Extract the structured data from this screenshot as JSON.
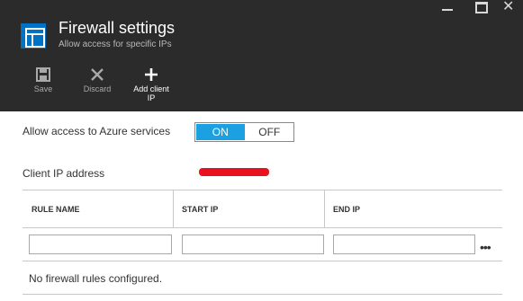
{
  "header": {
    "title": "Firewall settings",
    "subtitle": "Allow access for specific IPs",
    "icon": "firewall-blade-icon"
  },
  "window_controls": [
    "minimize-icon",
    "maximize-icon",
    "close-icon"
  ],
  "commands": [
    {
      "label": "Save",
      "icon": "save-icon",
      "enabled": false
    },
    {
      "label": "Discard",
      "icon": "discard-icon",
      "enabled": false
    },
    {
      "label": "Add client\nIP",
      "icon": "plus-icon",
      "enabled": true
    }
  ],
  "azure_access": {
    "label": "Allow access to Azure services",
    "on_label": "ON",
    "off_label": "OFF",
    "selected": "ON"
  },
  "client_ip": {
    "label": "Client IP address"
  },
  "table": {
    "columns": [
      "RULE NAME",
      "START IP",
      "END IP"
    ],
    "inputs": {
      "rule_name": "",
      "start_ip": "",
      "end_ip": ""
    },
    "more_icon": "ellipsis-icon",
    "empty_message": "No firewall rules configured."
  },
  "colors": {
    "header_bg": "#2b2b2b",
    "accent": "#1ba1e2",
    "blade_icon": "#0072c6",
    "redaction": "#e8111f"
  }
}
